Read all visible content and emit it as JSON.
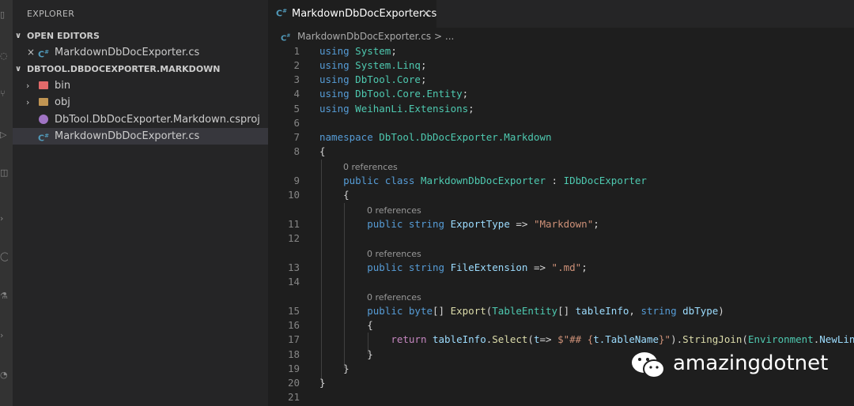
{
  "sidebar": {
    "title": "EXPLORER",
    "open_editors": {
      "label": "OPEN EDITORS",
      "items": [
        {
          "close": "×",
          "icon": "csharp-icon",
          "label": "MarkdownDbDocExporter.cs"
        }
      ]
    },
    "project": {
      "label": "DBTOOL.DBDOCEXPORTER.MARKDOWN",
      "items": [
        {
          "label": "bin",
          "icon": "folder-icon"
        },
        {
          "label": "obj",
          "icon": "folder-icon"
        },
        {
          "label": "DbTool.DbDocExporter.Markdown.csproj",
          "icon": "csproj-icon"
        },
        {
          "label": "MarkdownDbDocExporter.cs",
          "icon": "csharp-icon"
        }
      ]
    }
  },
  "tab": {
    "label": "MarkdownDbDocExporter.cs",
    "close": "×"
  },
  "breadcrumb": {
    "file": "MarkdownDbDocExporter.cs",
    "sep": ">",
    "more": "..."
  },
  "lens": {
    "references": "0 references"
  },
  "editor": {
    "line_numbers": [
      "1",
      "2",
      "3",
      "4",
      "5",
      "6",
      "7",
      "8",
      "9",
      "10",
      "11",
      "12",
      "13",
      "14",
      "15",
      "16",
      "17",
      "18",
      "19",
      "20",
      "21"
    ],
    "kw": {
      "using": "using",
      "namespace": "namespace",
      "public": "public",
      "class": "class",
      "string": "string",
      "byte": "byte",
      "return": "return"
    },
    "ns": {
      "system": "System",
      "linq": "System.Linq",
      "core": "DbTool.Core",
      "entity": "DbTool.Core.Entity",
      "ext": "WeihanLi.Extensions",
      "markdown": "DbTool.DbDocExporter.Markdown"
    },
    "ident": {
      "class_name": "MarkdownDbDocExporter",
      "interface": "IDbDocExporter",
      "export_type": "ExportType",
      "file_extension": "FileExtension",
      "export": "Export",
      "table_entity": "TableEntity",
      "table_info": "tableInfo",
      "db_type": "dbType",
      "select": "Select",
      "t": "t",
      "string_join": "StringJoin",
      "environment": "Environment",
      "new_line": "NewLine"
    },
    "str": {
      "markdown": "\"Markdown\"",
      "md": "\".md\"",
      "interp_start": "$\"## {",
      "interp_end": "}\""
    },
    "member": {
      "table_name": "t.TableName"
    }
  },
  "watermark": {
    "text": "amazingdotnet",
    "icon": "wechat-icon"
  },
  "colors": {
    "keyword": "#569cd6",
    "control": "#c586c0",
    "type": "#4ec9b0",
    "string": "#ce9178",
    "function": "#dcdcaa",
    "variable": "#9cdcfe"
  }
}
